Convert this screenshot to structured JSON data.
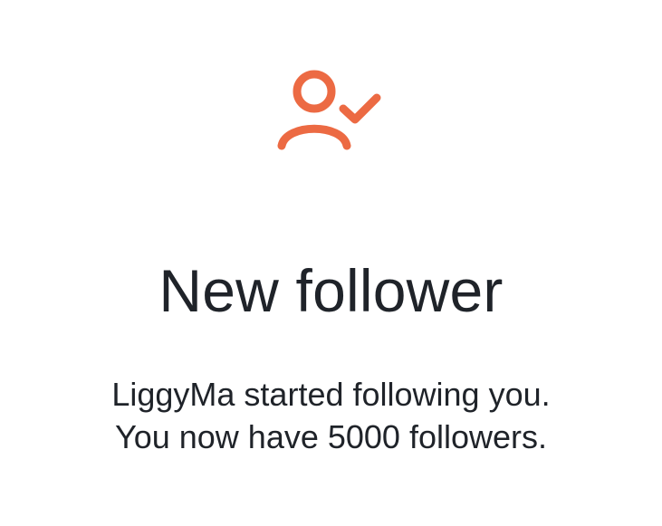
{
  "notification": {
    "icon": "user-check-icon",
    "accent_color": "#ec6a43",
    "title": "New follower",
    "message_lines": [
      "LiggyMa started following you.",
      "You now have 5000 followers."
    ]
  }
}
